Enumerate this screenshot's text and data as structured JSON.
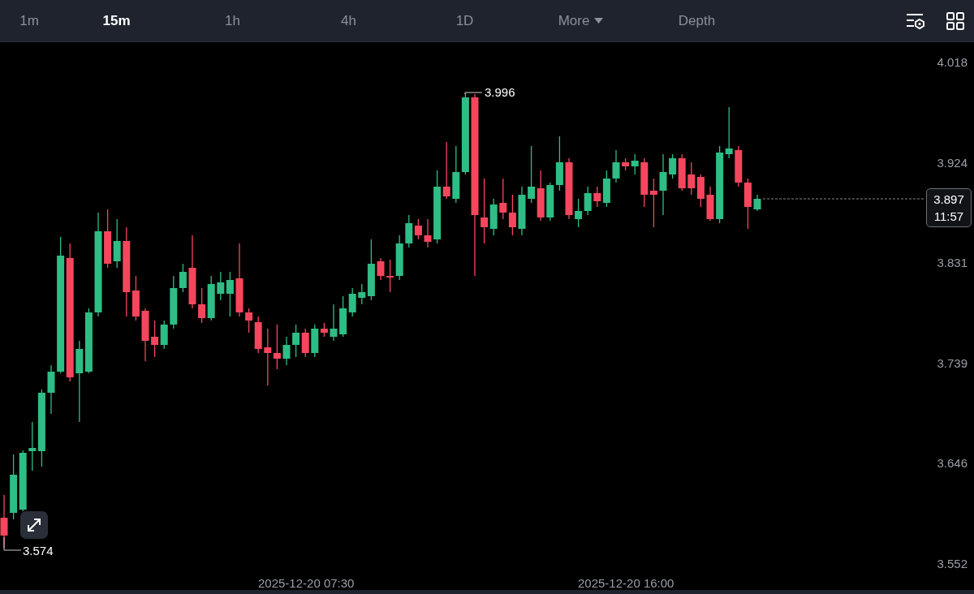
{
  "toolbar": {
    "tabs": [
      {
        "label": "1m",
        "kind": "tab",
        "selected": false
      },
      {
        "label": "15m",
        "kind": "tab",
        "selected": true
      },
      {
        "label": "1h",
        "kind": "tab",
        "selected": false
      },
      {
        "label": "4h",
        "kind": "tab",
        "selected": false
      },
      {
        "label": "1D",
        "kind": "tab",
        "selected": false
      },
      {
        "label": "More",
        "kind": "dropdown",
        "selected": false
      },
      {
        "label": "Depth",
        "kind": "tab",
        "selected": false
      }
    ]
  },
  "chart": {
    "price_axis": [
      "4.018",
      "3.924",
      "3.831",
      "3.739",
      "3.646",
      "3.552"
    ],
    "time_axis": [
      "2025-12-20 07:30",
      "2025-12-20 16:00"
    ],
    "high_label": "3.996",
    "low_label": "3.574",
    "price_tag": {
      "price": "3.897",
      "countdown": "11:57"
    }
  }
}
